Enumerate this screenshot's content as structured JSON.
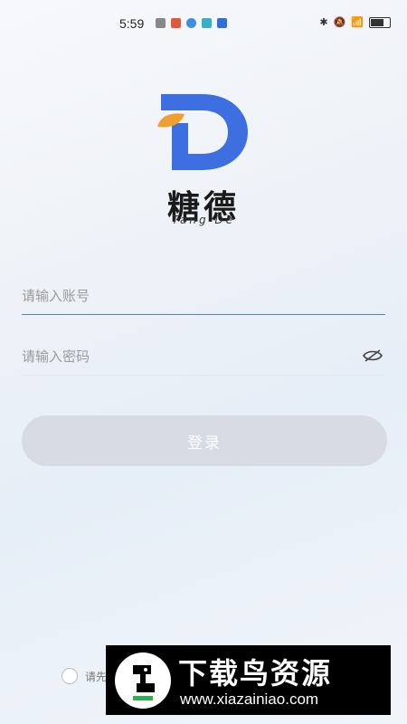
{
  "status_bar": {
    "time": "5:59"
  },
  "brand": {
    "name_cn": "糖德",
    "name_en": "Tang De"
  },
  "login": {
    "account_placeholder": "请输入账号",
    "password_placeholder": "请输入密码",
    "button_label": "登录"
  },
  "agreement": {
    "text_visible": "请先"
  },
  "watermark": {
    "title": "下载鸟资源",
    "url": "www.xiazainiao.com"
  },
  "colors": {
    "logo_blue": "#3d6fe0",
    "logo_orange": "#f0a030",
    "input_focus": "#5b7ec9",
    "button_disabled": "#d7dbe3"
  }
}
